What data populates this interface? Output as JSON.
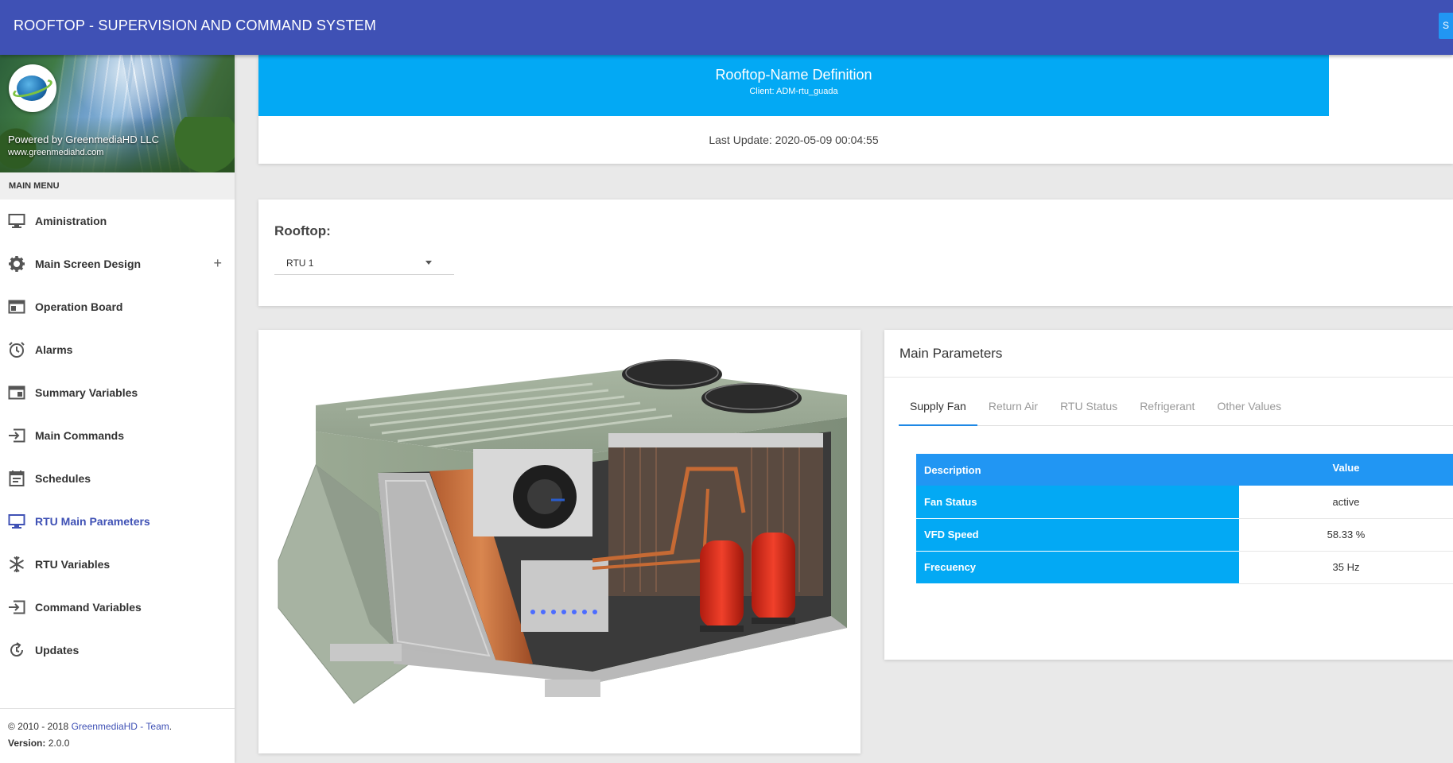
{
  "app": {
    "title": "ROOFTOP - SUPERVISION AND COMMAND SYSTEM",
    "top_button_label": "S"
  },
  "sidebar": {
    "powered_by": "Powered by GreenmediaHD LLC",
    "website": "www.greenmediahd.com",
    "menu_header": "MAIN MENU",
    "items": [
      {
        "label": "Aministration",
        "icon": "monitor-icon"
      },
      {
        "label": "Main Screen Design",
        "icon": "gear-icon",
        "expand": "+"
      },
      {
        "label": "Operation Board",
        "icon": "dashboard-icon"
      },
      {
        "label": "Alarms",
        "icon": "alarm-clock-icon"
      },
      {
        "label": "Summary Variables",
        "icon": "summary-icon"
      },
      {
        "label": "Main Commands",
        "icon": "input-arrow-icon"
      },
      {
        "label": "Schedules",
        "icon": "calendar-icon"
      },
      {
        "label": "RTU Main Parameters",
        "icon": "monitor-icon",
        "active": true
      },
      {
        "label": "RTU Variables",
        "icon": "snowflake-icon"
      },
      {
        "label": "Command Variables",
        "icon": "input-arrow-icon"
      },
      {
        "label": "Updates",
        "icon": "refresh-icon"
      }
    ],
    "footer": {
      "copyright": "© 2010 - 2018 ",
      "brand": "GreenmediaHD - Team",
      "dot": ".",
      "version_label": "Version:",
      "version": " 2.0.0"
    }
  },
  "header": {
    "title": "Rooftop-Name Definition",
    "client": "Client: ADM-rtu_guada",
    "last_update": "Last Update: 2020-05-09 00:04:55"
  },
  "rooftop_select": {
    "label": "Rooftop:",
    "selected": "RTU 1"
  },
  "main_parameters": {
    "title": "Main Parameters",
    "tabs": [
      "Supply Fan",
      "Return Air",
      "RTU Status",
      "Refrigerant",
      "Other Values"
    ],
    "active_tab": 0,
    "table": {
      "headers": {
        "description": "Description",
        "value": "Value"
      },
      "rows": [
        {
          "description": "Fan Status",
          "value": "active"
        },
        {
          "description": "VFD Speed",
          "value": "58.33 %"
        },
        {
          "description": "Frecuency",
          "value": "35 Hz"
        }
      ]
    }
  },
  "colors": {
    "topbar": "#3f51b5",
    "header_blue": "#03a9f4",
    "table_header": "#2196f3",
    "active_menu": "#3f51b5"
  }
}
